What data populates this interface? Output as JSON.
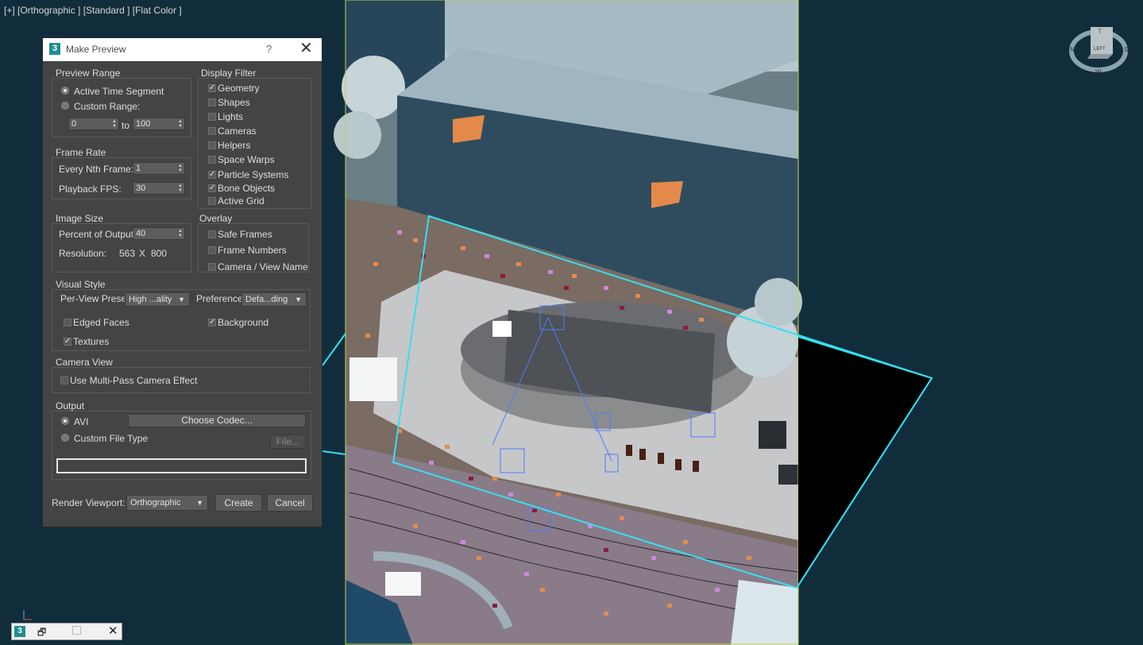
{
  "viewport": {
    "label": "[+] [Orthographic ] [Standard ] [Flat Color ]"
  },
  "viewcube": {
    "top_label": "T",
    "face_label": "LEFT",
    "compass_n": "N",
    "compass_s": "S",
    "compass_w": "W"
  },
  "dialog": {
    "title": "Make Preview",
    "help": "?",
    "close": "✕",
    "preview_range": {
      "title": "Preview Range",
      "active_time_segment": "Active Time Segment",
      "custom_range": "Custom Range:",
      "from": "0",
      "to_label": "to",
      "to": "100",
      "selected": "active_time_segment"
    },
    "frame_rate": {
      "title": "Frame Rate",
      "every_nth_label": "Every Nth Frame:",
      "every_nth": "1",
      "fps_label": "Playback FPS:",
      "fps": "30"
    },
    "image_size": {
      "title": "Image Size",
      "percent_label": "Percent of Output:",
      "percent": "40",
      "resolution_label": "Resolution:",
      "width": "563",
      "x": "X",
      "height": "800"
    },
    "display_filter": {
      "title": "Display Filter",
      "items": [
        {
          "label": "Geometry",
          "checked": true
        },
        {
          "label": "Shapes",
          "checked": false
        },
        {
          "label": "Lights",
          "checked": false
        },
        {
          "label": "Cameras",
          "checked": false
        },
        {
          "label": "Helpers",
          "checked": false
        },
        {
          "label": "Space Warps",
          "checked": false
        },
        {
          "label": "Particle Systems",
          "checked": true
        },
        {
          "label": "Bone Objects",
          "checked": true
        },
        {
          "label": "Active Grid",
          "checked": false
        }
      ]
    },
    "overlay": {
      "title": "Overlay",
      "items": [
        {
          "label": "Safe Frames",
          "checked": false
        },
        {
          "label": "Frame Numbers",
          "checked": false
        },
        {
          "label": "Camera / View Name",
          "checked": false
        }
      ]
    },
    "visual_style": {
      "title": "Visual Style",
      "presets_label": "Per-View Presets",
      "presets_value": "High ...ality",
      "preference_label": "Preference:",
      "preference_value": "Defa...ding",
      "edged_faces": "Edged Faces",
      "edged_faces_checked": false,
      "background": "Background",
      "background_checked": true,
      "textures": "Textures",
      "textures_checked": true
    },
    "camera_view": {
      "title": "Camera View",
      "multipass": "Use Multi-Pass Camera Effect",
      "multipass_checked": false
    },
    "output": {
      "title": "Output",
      "avi": "AVI",
      "custom": "Custom File Type",
      "choose_codec": "Choose Codec...",
      "file": "File...",
      "path": "",
      "selected": "avi"
    },
    "footer": {
      "render_viewport_label": "Render Viewport:",
      "render_viewport": "Orthographic",
      "create": "Create",
      "cancel": "Cancel"
    }
  },
  "colors": {
    "viewport_bg": "#112d3c",
    "dialog_bg": "#444444",
    "camera_frustum": "#35e0f0",
    "safe_frame": "#c9d24a"
  }
}
